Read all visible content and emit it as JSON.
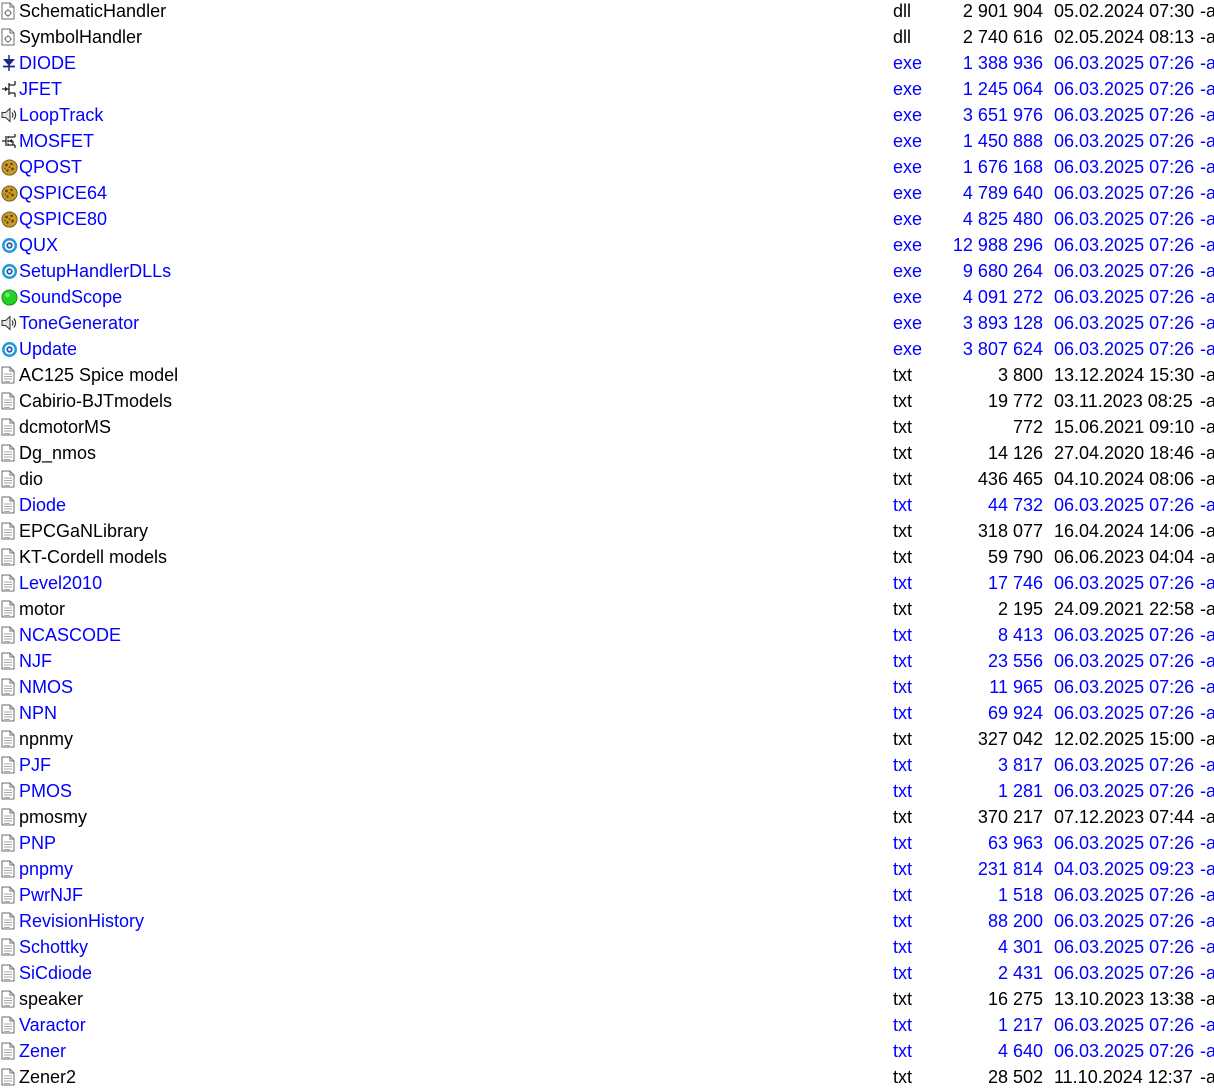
{
  "files": [
    {
      "name": "SchematicHandler",
      "ext": "dll",
      "size": "2 901 904",
      "date": "05.02.2024 07:30",
      "attr": "-a",
      "icon": "dll-file-icon",
      "highlight": false
    },
    {
      "name": "SymbolHandler",
      "ext": "dll",
      "size": "2 740 616",
      "date": "02.05.2024 08:13",
      "attr": "-a",
      "icon": "dll-file-icon",
      "highlight": false
    },
    {
      "name": "DIODE",
      "ext": "exe",
      "size": "1 388 936",
      "date": "06.03.2025 07:26",
      "attr": "-a",
      "icon": "diode-symbol-icon",
      "highlight": true
    },
    {
      "name": "JFET",
      "ext": "exe",
      "size": "1 245 064",
      "date": "06.03.2025 07:26",
      "attr": "-a",
      "icon": "jfet-symbol-icon",
      "highlight": true
    },
    {
      "name": "LoopTrack",
      "ext": "exe",
      "size": "3 651 976",
      "date": "06.03.2025 07:26",
      "attr": "-a",
      "icon": "speaker-icon",
      "highlight": true
    },
    {
      "name": "MOSFET",
      "ext": "exe",
      "size": "1 450 888",
      "date": "06.03.2025 07:26",
      "attr": "-a",
      "icon": "mosfet-symbol-icon",
      "highlight": true
    },
    {
      "name": "QPOST",
      "ext": "exe",
      "size": "1 676 168",
      "date": "06.03.2025 07:26",
      "attr": "-a",
      "icon": "qspice-cookie-icon",
      "highlight": true
    },
    {
      "name": "QSPICE64",
      "ext": "exe",
      "size": "4 789 640",
      "date": "06.03.2025 07:26",
      "attr": "-a",
      "icon": "qspice-cookie-icon",
      "highlight": true
    },
    {
      "name": "QSPICE80",
      "ext": "exe",
      "size": "4 825 480",
      "date": "06.03.2025 07:26",
      "attr": "-a",
      "icon": "qspice-cookie-icon",
      "highlight": true
    },
    {
      "name": "QUX",
      "ext": "exe",
      "size": "12 988 296",
      "date": "06.03.2025 07:26",
      "attr": "-a",
      "icon": "blue-target-icon",
      "highlight": true
    },
    {
      "name": "SetupHandlerDLLs",
      "ext": "exe",
      "size": "9 680 264",
      "date": "06.03.2025 07:26",
      "attr": "-a",
      "icon": "blue-target-icon",
      "highlight": true
    },
    {
      "name": "SoundScope",
      "ext": "exe",
      "size": "4 091 272",
      "date": "06.03.2025 07:26",
      "attr": "-a",
      "icon": "green-circle-icon",
      "highlight": true
    },
    {
      "name": "ToneGenerator",
      "ext": "exe",
      "size": "3 893 128",
      "date": "06.03.2025 07:26",
      "attr": "-a",
      "icon": "speaker-icon",
      "highlight": true
    },
    {
      "name": "Update",
      "ext": "exe",
      "size": "3 807 624",
      "date": "06.03.2025 07:26",
      "attr": "-a",
      "icon": "blue-target-icon",
      "highlight": true
    },
    {
      "name": "AC125 Spice model",
      "ext": "txt",
      "size": "3 800",
      "date": "13.12.2024 15:30",
      "attr": "-a",
      "icon": "text-file-icon",
      "highlight": false
    },
    {
      "name": "Cabirio-BJTmodels",
      "ext": "txt",
      "size": "19 772",
      "date": "03.11.2023 08:25",
      "attr": "-a",
      "icon": "text-file-icon",
      "highlight": false
    },
    {
      "name": "dcmotorMS",
      "ext": "txt",
      "size": "772",
      "date": "15.06.2021 09:10",
      "attr": "-a",
      "icon": "text-file-icon",
      "highlight": false
    },
    {
      "name": "Dg_nmos",
      "ext": "txt",
      "size": "14 126",
      "date": "27.04.2020 18:46",
      "attr": "-a",
      "icon": "text-file-icon",
      "highlight": false
    },
    {
      "name": "dio",
      "ext": "txt",
      "size": "436 465",
      "date": "04.10.2024 08:06",
      "attr": "-a",
      "icon": "text-file-icon",
      "highlight": false
    },
    {
      "name": "Diode",
      "ext": "txt",
      "size": "44 732",
      "date": "06.03.2025 07:26",
      "attr": "-a",
      "icon": "text-file-icon",
      "highlight": true
    },
    {
      "name": "EPCGaNLibrary",
      "ext": "txt",
      "size": "318 077",
      "date": "16.04.2024 14:06",
      "attr": "-a",
      "icon": "text-file-icon",
      "highlight": false
    },
    {
      "name": "KT-Cordell models",
      "ext": "txt",
      "size": "59 790",
      "date": "06.06.2023 04:04",
      "attr": "-a",
      "icon": "text-file-icon",
      "highlight": false
    },
    {
      "name": "Level2010",
      "ext": "txt",
      "size": "17 746",
      "date": "06.03.2025 07:26",
      "attr": "-a",
      "icon": "text-file-icon",
      "highlight": true
    },
    {
      "name": "motor",
      "ext": "txt",
      "size": "2 195",
      "date": "24.09.2021 22:58",
      "attr": "-a",
      "icon": "text-file-icon",
      "highlight": false
    },
    {
      "name": "NCASCODE",
      "ext": "txt",
      "size": "8 413",
      "date": "06.03.2025 07:26",
      "attr": "-a",
      "icon": "text-file-icon",
      "highlight": true
    },
    {
      "name": "NJF",
      "ext": "txt",
      "size": "23 556",
      "date": "06.03.2025 07:26",
      "attr": "-a",
      "icon": "text-file-icon",
      "highlight": true
    },
    {
      "name": "NMOS",
      "ext": "txt",
      "size": "11 965",
      "date": "06.03.2025 07:26",
      "attr": "-a",
      "icon": "text-file-icon",
      "highlight": true
    },
    {
      "name": "NPN",
      "ext": "txt",
      "size": "69 924",
      "date": "06.03.2025 07:26",
      "attr": "-a",
      "icon": "text-file-icon",
      "highlight": true
    },
    {
      "name": "npnmy",
      "ext": "txt",
      "size": "327 042",
      "date": "12.02.2025 15:00",
      "attr": "-a",
      "icon": "text-file-icon",
      "highlight": false
    },
    {
      "name": "PJF",
      "ext": "txt",
      "size": "3 817",
      "date": "06.03.2025 07:26",
      "attr": "-a",
      "icon": "text-file-icon",
      "highlight": true
    },
    {
      "name": "PMOS",
      "ext": "txt",
      "size": "1 281",
      "date": "06.03.2025 07:26",
      "attr": "-a",
      "icon": "text-file-icon",
      "highlight": true
    },
    {
      "name": "pmosmy",
      "ext": "txt",
      "size": "370 217",
      "date": "07.12.2023 07:44",
      "attr": "-a",
      "icon": "text-file-icon",
      "highlight": false
    },
    {
      "name": "PNP",
      "ext": "txt",
      "size": "63 963",
      "date": "06.03.2025 07:26",
      "attr": "-a",
      "icon": "text-file-icon",
      "highlight": true
    },
    {
      "name": "pnpmy",
      "ext": "txt",
      "size": "231 814",
      "date": "04.03.2025 09:23",
      "attr": "-a",
      "icon": "text-file-icon",
      "highlight": true
    },
    {
      "name": "PwrNJF",
      "ext": "txt",
      "size": "1 518",
      "date": "06.03.2025 07:26",
      "attr": "-a",
      "icon": "text-file-icon",
      "highlight": true
    },
    {
      "name": "RevisionHistory",
      "ext": "txt",
      "size": "88 200",
      "date": "06.03.2025 07:26",
      "attr": "-a",
      "icon": "text-file-icon",
      "highlight": true
    },
    {
      "name": "Schottky",
      "ext": "txt",
      "size": "4 301",
      "date": "06.03.2025 07:26",
      "attr": "-a",
      "icon": "text-file-icon",
      "highlight": true
    },
    {
      "name": "SiCdiode",
      "ext": "txt",
      "size": "2 431",
      "date": "06.03.2025 07:26",
      "attr": "-a",
      "icon": "text-file-icon",
      "highlight": true
    },
    {
      "name": "speaker",
      "ext": "txt",
      "size": "16 275",
      "date": "13.10.2023 13:38",
      "attr": "-a",
      "icon": "text-file-icon",
      "highlight": false
    },
    {
      "name": "Varactor",
      "ext": "txt",
      "size": "1 217",
      "date": "06.03.2025 07:26",
      "attr": "-a",
      "icon": "text-file-icon",
      "highlight": true
    },
    {
      "name": "Zener",
      "ext": "txt",
      "size": "4 640",
      "date": "06.03.2025 07:26",
      "attr": "-a",
      "icon": "text-file-icon",
      "highlight": true
    },
    {
      "name": "Zener2",
      "ext": "txt",
      "size": "28 502",
      "date": "11.10.2024 12:37",
      "attr": "-a",
      "icon": "text-file-icon",
      "highlight": false
    }
  ],
  "colors": {
    "highlight_text": "#0000ff",
    "normal_text": "#000000",
    "background": "#ffffff"
  }
}
